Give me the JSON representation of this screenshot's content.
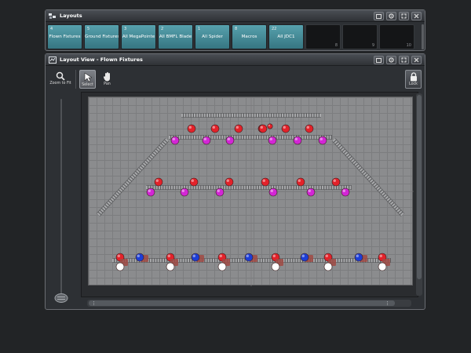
{
  "layouts_window": {
    "title": "Layouts",
    "buttons": [
      {
        "number": "4",
        "label": "Flown Fixtures"
      },
      {
        "number": "5",
        "label": "Ground Fixtures"
      },
      {
        "number": "3",
        "label": "All MegaPointe"
      },
      {
        "number": "2",
        "label": "All BMFL Blade"
      },
      {
        "number": "1",
        "label": "All Spider"
      },
      {
        "number": "8",
        "label": "Macros"
      },
      {
        "number": "22",
        "label": "All JDC1"
      },
      {
        "number": "8",
        "label": ""
      },
      {
        "number": "9",
        "label": ""
      },
      {
        "number": "10",
        "label": ""
      }
    ]
  },
  "layout_view_window": {
    "title": "Layout View - Flown Fixtures",
    "tools": {
      "zoom_to_fit": "Zoom to Fit",
      "select": "Select",
      "pan": "Pan",
      "lock": "Lock"
    }
  },
  "colors": {
    "button_teal": "#4a8f9b",
    "fixture_red": "#e3222a",
    "fixture_magenta": "#d326d6",
    "fixture_blue": "#1d3ed6",
    "fixture_white": "#ffffff",
    "truss": "#a8a9ab",
    "canvas": "#8b8c8e"
  },
  "fixtures": {
    "upper_arc_red": 7,
    "upper_arc_magenta": 6,
    "middle_row_red": 6,
    "middle_row_magenta": 6,
    "bottom_row_red": 8,
    "bottom_row_blue": 5,
    "bottom_row_white": 6
  }
}
